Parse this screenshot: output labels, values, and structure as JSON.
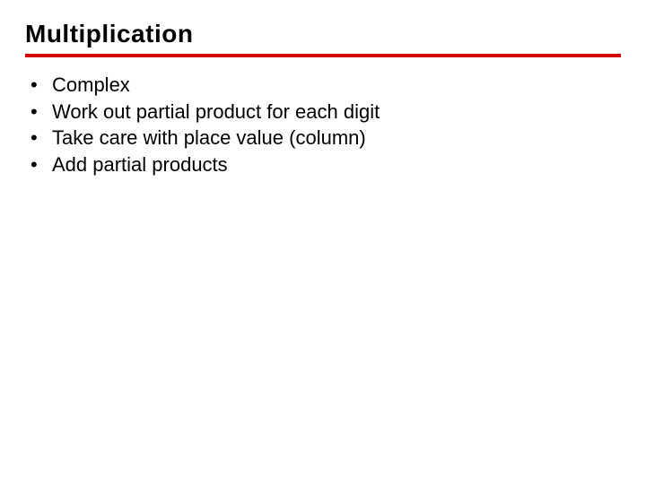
{
  "slide": {
    "title": "Multiplication",
    "bullets": [
      "Complex",
      "Work out partial product for each digit",
      "Take care with place value (column)",
      "Add partial products"
    ]
  }
}
